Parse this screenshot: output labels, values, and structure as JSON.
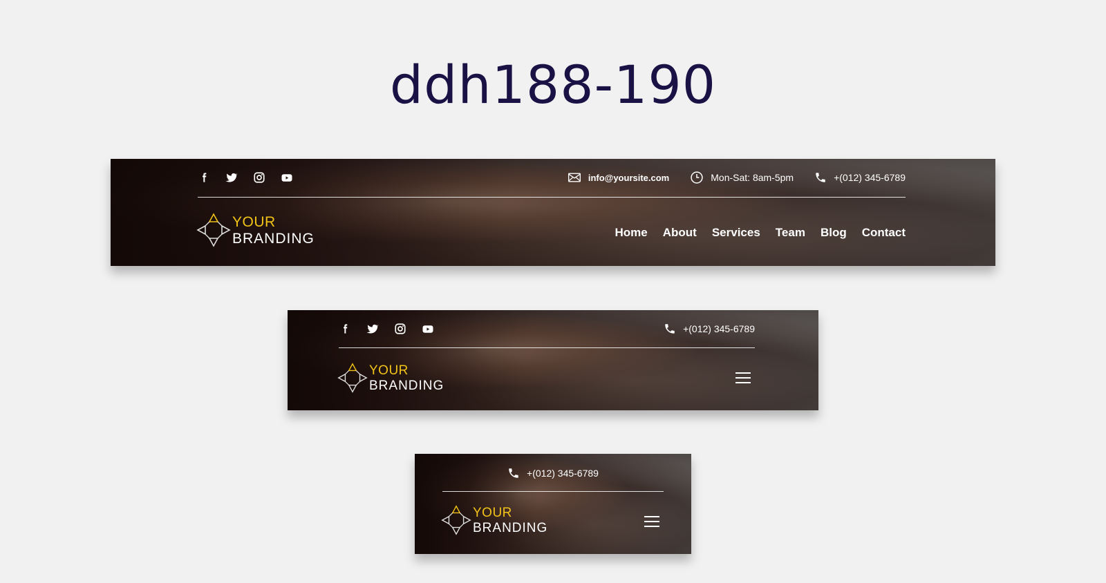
{
  "page": {
    "title": "ddh188-190"
  },
  "header": {
    "email": "info@yoursite.com",
    "hours": "Mon-Sat: 8am-5pm",
    "phone": "+(012) 345-6789",
    "logo_line1": "YOUR",
    "logo_line2": "BRANDING",
    "nav": [
      "Home",
      "About",
      "Services",
      "Team",
      "Blog",
      "Contact"
    ],
    "social_icons": [
      "facebook-icon",
      "twitter-icon",
      "instagram-icon",
      "youtube-icon"
    ]
  },
  "colors": {
    "title": "#1a1145",
    "logo_accent": "#f2c318",
    "background": "#f1f1f1"
  }
}
